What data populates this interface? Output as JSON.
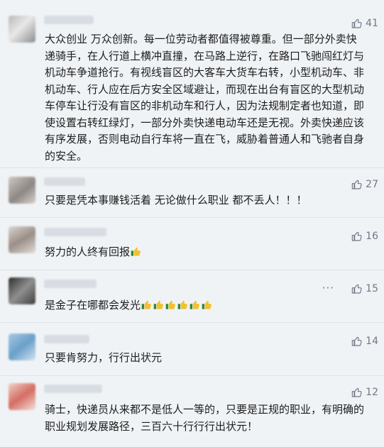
{
  "comments": [
    {
      "text": "大众创业 万众创新。每一位劳动者都值得被尊重。但一部分外卖快递骑手，在人行道上横冲直撞，在马路上逆行，在路口飞驰闯红灯与机动车争道抢行。有视线盲区的大客车大货车右转，小型机动车、非机动车、行人应在后方安全区域避让，而现在出台有盲区的大型机动车停车让行没有盲区的非机动车和行人，因为法规制定者也知道，即使设置右转红绿灯，一部分外卖快递电动车还是无视。外卖快递应该有序发展，否则电动自行车将一直在飞，威胁着普通人和飞驰者自身的安全。",
      "likes": "41"
    },
    {
      "text": "只要是凭本事赚钱活着 无论做什么职业 都不丢人！！！",
      "likes": "27"
    },
    {
      "text": "努力的人终有回报",
      "likes": "16"
    },
    {
      "text": "是金子在哪都会发光",
      "likes": "15",
      "more": "···"
    },
    {
      "text": "只要肯努力，行行出状元",
      "likes": "14"
    },
    {
      "text": "骑士，快递员从来都不是低人一等的，只要是正规的职业，有明确的职业规划发展路径，三百六十行行行出状元！",
      "likes": "12"
    }
  ],
  "icons": {
    "like": "thumbs-up-outline-icon",
    "emoji": "thumbs-up-emoji-icon"
  },
  "colors": {
    "background": "#f0f3f6",
    "text": "#1d1d1d",
    "meta": "#6f7885",
    "divider": "#dde3ea"
  }
}
